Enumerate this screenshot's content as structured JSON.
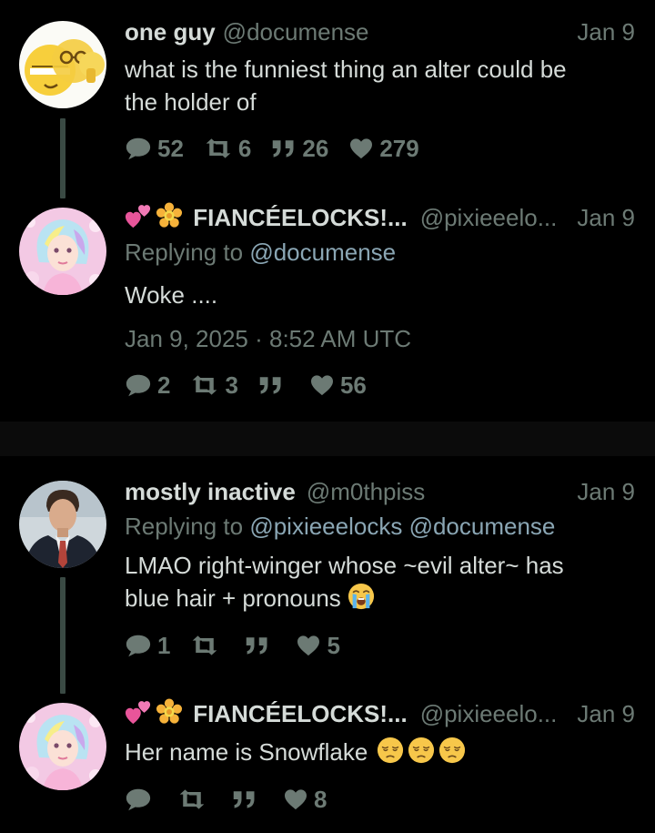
{
  "colors": {
    "background": "#000000",
    "primary_text": "#d5dbd8",
    "secondary_text": "#6c7a74",
    "mention": "#8aa6b4",
    "thread_line": "#3a4a44"
  },
  "tweets": [
    {
      "name": "one guy",
      "handle": "@documense",
      "date": "Jan 9",
      "text_lines": [
        "what is the funniest thing an alter could be",
        "the holder of"
      ],
      "stats": {
        "replies": "52",
        "retweets": "6",
        "quotes": "26",
        "likes": "279"
      },
      "avatar_icon": "emoji-collage-avatar"
    },
    {
      "name_emoji": [
        "two-hearts-emoji",
        "blossom-emoji"
      ],
      "name": "FIANCÉELOCKS!...",
      "handle": "@pixieeelo...",
      "date": "Jan 9",
      "replying_prefix": "Replying to",
      "replying_mentions": [
        "@documense"
      ],
      "text": "Woke ....",
      "timestamp": "Jan 9, 2025 · 8:52 AM UTC",
      "stats": {
        "replies": "2",
        "retweets": "3",
        "quotes": "",
        "likes": "56"
      },
      "avatar_icon": "pastel-portrait-avatar"
    },
    {
      "name": "mostly inactive",
      "handle": "@m0thpiss",
      "date": "Jan 9",
      "replying_prefix": "Replying to",
      "replying_mentions": [
        "@pixieeelocks",
        "@documense"
      ],
      "text_lines": [
        "LMAO right-winger whose ~evil alter~ has",
        "blue hair + pronouns"
      ],
      "text_emoji": "loudly-crying-emoji",
      "stats": {
        "replies": "1",
        "retweets": "",
        "quotes": "",
        "likes": "5"
      },
      "avatar_icon": "suit-portrait-avatar"
    },
    {
      "name_emoji": [
        "two-hearts-emoji",
        "blossom-emoji"
      ],
      "name": "FIANCÉELOCKS!...",
      "handle": "@pixieeelo...",
      "date": "Jan 9",
      "text": "Her name is Snowflake",
      "text_emoji": [
        "pensive-emoji",
        "pensive-emoji",
        "pensive-emoji"
      ],
      "stats": {
        "replies": "",
        "retweets": "",
        "quotes": "",
        "likes": "8"
      },
      "avatar_icon": "pastel-portrait-avatar"
    }
  ]
}
